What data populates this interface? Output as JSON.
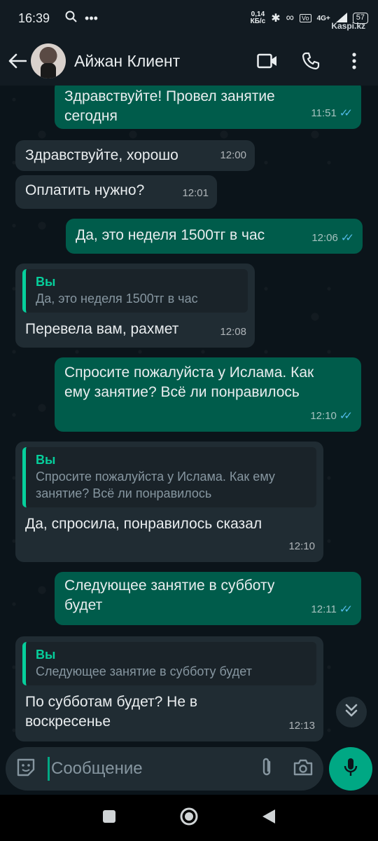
{
  "status_bar": {
    "time": "16:39",
    "net_speed_value": "0,14",
    "net_speed_unit": "КБ/с",
    "network": "4G+",
    "battery": "57",
    "watermark": "Kaspi.kz"
  },
  "header": {
    "contact_name": "Айжан Клиент"
  },
  "messages": [
    {
      "direction": "out",
      "text": "Здравствуйте! Провел занятие сегодня",
      "time": "11:51",
      "read": true
    },
    {
      "direction": "in",
      "text": "Здравствуйте, хорошо",
      "time": "12:00"
    },
    {
      "direction": "in",
      "text": "Оплатить нужно?",
      "time": "12:01"
    },
    {
      "direction": "out",
      "text": "Да, это неделя 1500тг в час",
      "time": "12:06",
      "read": true
    },
    {
      "direction": "in",
      "quote_name": "Вы",
      "quote_text": "Да, это неделя 1500тг в час",
      "text": "Перевела вам, рахмет",
      "time": "12:08"
    },
    {
      "direction": "out",
      "text": "Спросите пожалуйста у Ислама. Как ему занятие? Всё ли понравилось",
      "time": "12:10",
      "read": true
    },
    {
      "direction": "in",
      "quote_name": "Вы",
      "quote_text": "Спросите пожалуйста у Ислама. Как ему занятие? Всё ли понравилось",
      "text": "Да, спросила, понравилось сказал",
      "time": "12:10"
    },
    {
      "direction": "out",
      "text": "Следующее занятие в субботу будет",
      "time": "12:11",
      "read": true
    },
    {
      "direction": "in",
      "quote_name": "Вы",
      "quote_text": "Следующее занятие в субботу будет",
      "text": "По субботам будет? Не в воскресенье",
      "time": "12:13"
    }
  ],
  "composer": {
    "placeholder": "Сообщение"
  },
  "colors": {
    "outgoing_bubble": "#005c4b",
    "incoming_bubble": "#202c33",
    "accent": "#00a884",
    "read_ticks": "#53bdeb"
  }
}
